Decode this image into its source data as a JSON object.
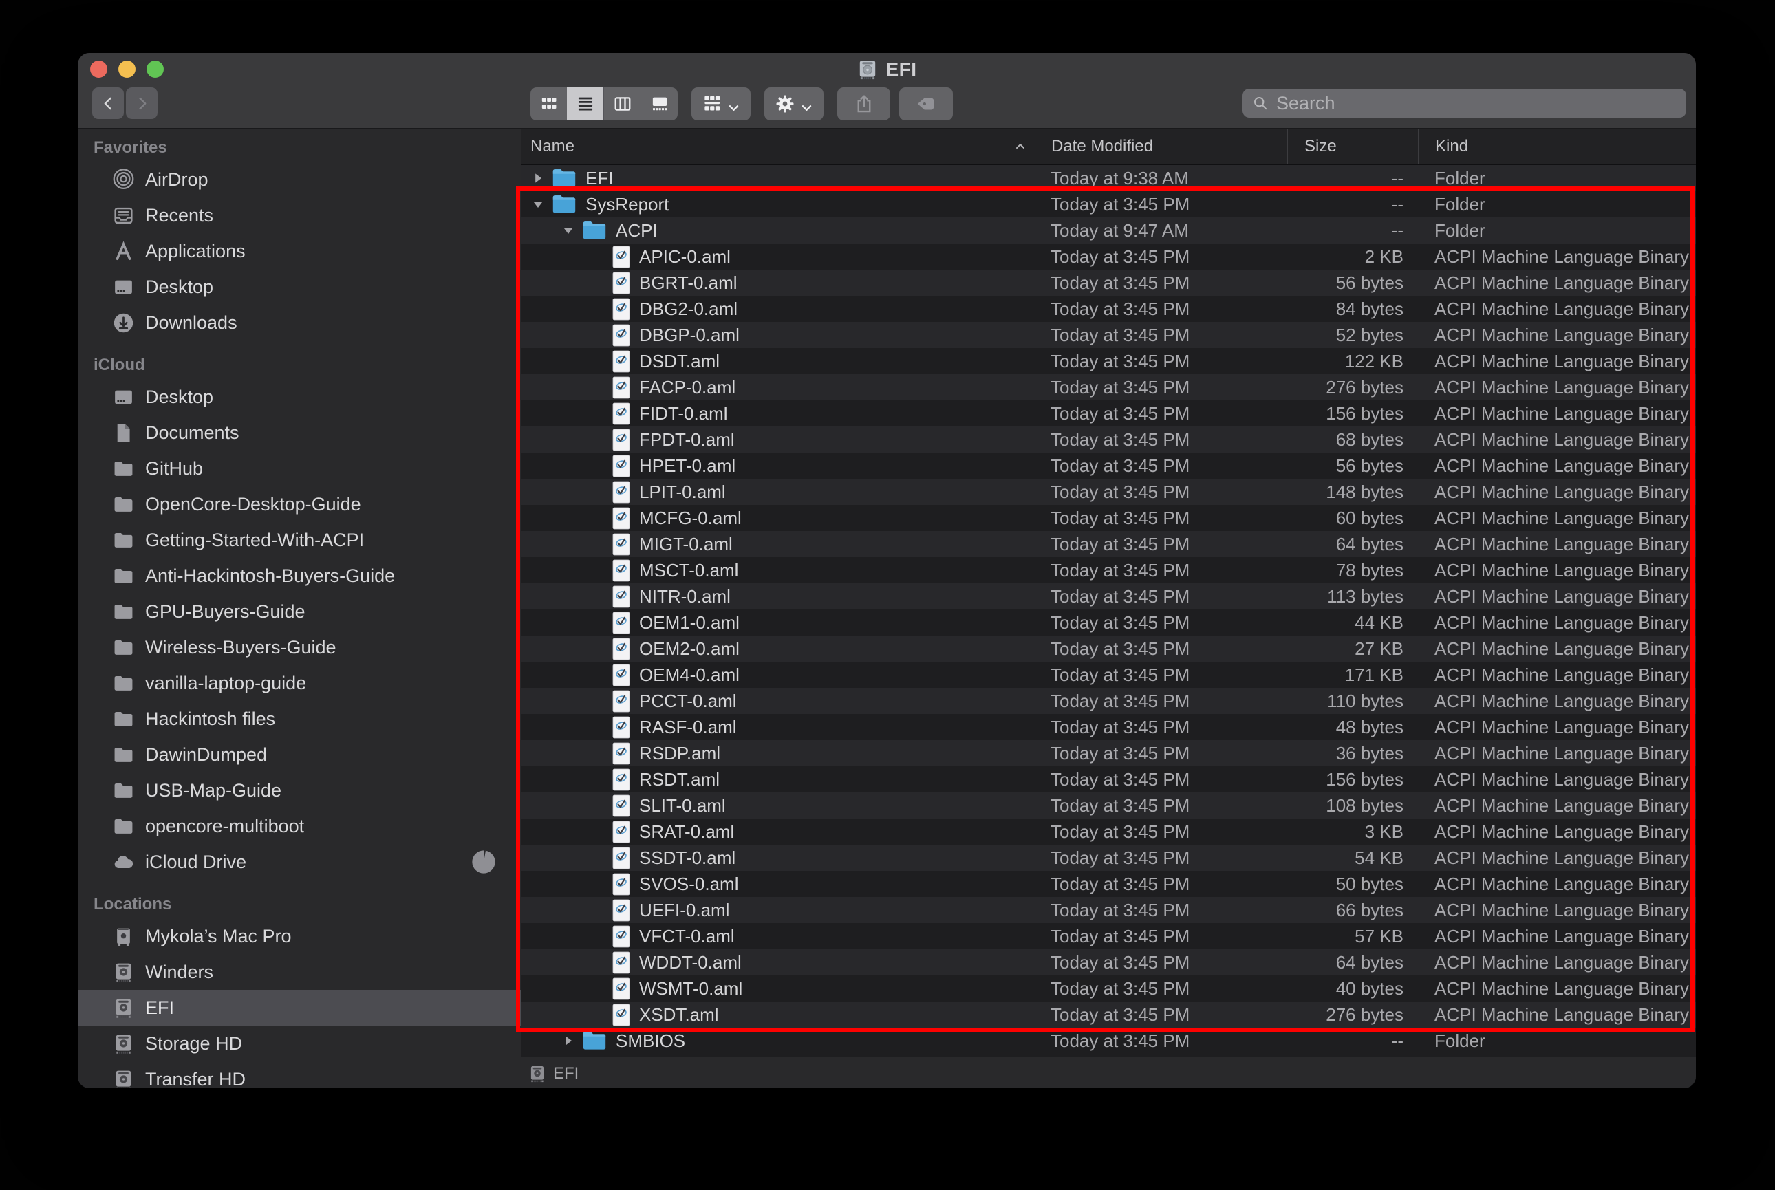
{
  "titlebar": {
    "title": "EFI",
    "title_icon": "drive-silver-icon",
    "search_placeholder": "Search",
    "view_options": [
      {
        "id": "icon-view",
        "icon": "icon-view-icon",
        "selected": false
      },
      {
        "id": "list-view",
        "icon": "list-view-icon",
        "selected": true
      },
      {
        "id": "column-view",
        "icon": "column-view-icon",
        "selected": false
      },
      {
        "id": "gallery-view",
        "icon": "gallery-view-icon",
        "selected": false
      }
    ]
  },
  "sidebar": {
    "sections": [
      {
        "label": "Favorites",
        "items": [
          {
            "label": "AirDrop",
            "icon": "airdrop-icon"
          },
          {
            "label": "Recents",
            "icon": "recents-icon"
          },
          {
            "label": "Applications",
            "icon": "applications-icon"
          },
          {
            "label": "Desktop",
            "icon": "desktop-icon"
          },
          {
            "label": "Downloads",
            "icon": "downloads-icon"
          }
        ]
      },
      {
        "label": "iCloud",
        "items": [
          {
            "label": "Desktop",
            "icon": "desktop-icon"
          },
          {
            "label": "Documents",
            "icon": "document-icon"
          },
          {
            "label": "GitHub",
            "icon": "folder-icon"
          },
          {
            "label": "OpenCore-Desktop-Guide",
            "icon": "folder-icon"
          },
          {
            "label": "Getting-Started-With-ACPI",
            "icon": "folder-icon"
          },
          {
            "label": "Anti-Hackintosh-Buyers-Guide",
            "icon": "folder-icon"
          },
          {
            "label": "GPU-Buyers-Guide",
            "icon": "folder-icon"
          },
          {
            "label": "Wireless-Buyers-Guide",
            "icon": "folder-icon"
          },
          {
            "label": "vanilla-laptop-guide",
            "icon": "folder-icon"
          },
          {
            "label": "Hackintosh files",
            "icon": "folder-icon"
          },
          {
            "label": "DawinDumped",
            "icon": "folder-icon"
          },
          {
            "label": "USB-Map-Guide",
            "icon": "folder-icon"
          },
          {
            "label": "opencore-multiboot",
            "icon": "folder-icon"
          },
          {
            "label": "iCloud Drive",
            "icon": "cloud-icon",
            "badge": "sync-pie-icon"
          }
        ]
      },
      {
        "label": "Locations",
        "items": [
          {
            "label": "Mykola’s Mac Pro",
            "icon": "macpro-icon"
          },
          {
            "label": "Winders",
            "icon": "drive-icon"
          },
          {
            "label": "EFI",
            "icon": "drive-icon",
            "selected": true
          },
          {
            "label": "Storage HD",
            "icon": "drive-icon"
          },
          {
            "label": "Transfer HD",
            "icon": "drive-icon"
          }
        ]
      }
    ]
  },
  "list": {
    "columns": [
      {
        "id": "name",
        "label": "Name",
        "sorted": "ascending"
      },
      {
        "id": "date",
        "label": "Date Modified"
      },
      {
        "id": "size",
        "label": "Size"
      },
      {
        "id": "kind",
        "label": "Kind"
      }
    ],
    "rows": [
      {
        "name": "EFI",
        "depth": 0,
        "icon": "folder-blue-icon",
        "twisty": "collapsed",
        "date": "Today at 9:38 AM",
        "size": "--",
        "kind": "Folder"
      },
      {
        "name": "SysReport",
        "depth": 0,
        "icon": "folder-blue-icon",
        "twisty": "expanded",
        "date": "Today at 3:45 PM",
        "size": "--",
        "kind": "Folder"
      },
      {
        "name": "ACPI",
        "depth": 1,
        "icon": "folder-blue-icon",
        "twisty": "expanded",
        "date": "Today at 9:47 AM",
        "size": "--",
        "kind": "Folder"
      },
      {
        "name": "APIC-0.aml",
        "depth": 2,
        "icon": "aml-file-icon",
        "twisty": "none",
        "date": "Today at 3:45 PM",
        "size": "2 KB",
        "kind": "ACPI Machine Language Binary"
      },
      {
        "name": "BGRT-0.aml",
        "depth": 2,
        "icon": "aml-file-icon",
        "twisty": "none",
        "date": "Today at 3:45 PM",
        "size": "56 bytes",
        "kind": "ACPI Machine Language Binary"
      },
      {
        "name": "DBG2-0.aml",
        "depth": 2,
        "icon": "aml-file-icon",
        "twisty": "none",
        "date": "Today at 3:45 PM",
        "size": "84 bytes",
        "kind": "ACPI Machine Language Binary"
      },
      {
        "name": "DBGP-0.aml",
        "depth": 2,
        "icon": "aml-file-icon",
        "twisty": "none",
        "date": "Today at 3:45 PM",
        "size": "52 bytes",
        "kind": "ACPI Machine Language Binary"
      },
      {
        "name": "DSDT.aml",
        "depth": 2,
        "icon": "aml-file-icon",
        "twisty": "none",
        "date": "Today at 3:45 PM",
        "size": "122 KB",
        "kind": "ACPI Machine Language Binary"
      },
      {
        "name": "FACP-0.aml",
        "depth": 2,
        "icon": "aml-file-icon",
        "twisty": "none",
        "date": "Today at 3:45 PM",
        "size": "276 bytes",
        "kind": "ACPI Machine Language Binary"
      },
      {
        "name": "FIDT-0.aml",
        "depth": 2,
        "icon": "aml-file-icon",
        "twisty": "none",
        "date": "Today at 3:45 PM",
        "size": "156 bytes",
        "kind": "ACPI Machine Language Binary"
      },
      {
        "name": "FPDT-0.aml",
        "depth": 2,
        "icon": "aml-file-icon",
        "twisty": "none",
        "date": "Today at 3:45 PM",
        "size": "68 bytes",
        "kind": "ACPI Machine Language Binary"
      },
      {
        "name": "HPET-0.aml",
        "depth": 2,
        "icon": "aml-file-icon",
        "twisty": "none",
        "date": "Today at 3:45 PM",
        "size": "56 bytes",
        "kind": "ACPI Machine Language Binary"
      },
      {
        "name": "LPIT-0.aml",
        "depth": 2,
        "icon": "aml-file-icon",
        "twisty": "none",
        "date": "Today at 3:45 PM",
        "size": "148 bytes",
        "kind": "ACPI Machine Language Binary"
      },
      {
        "name": "MCFG-0.aml",
        "depth": 2,
        "icon": "aml-file-icon",
        "twisty": "none",
        "date": "Today at 3:45 PM",
        "size": "60 bytes",
        "kind": "ACPI Machine Language Binary"
      },
      {
        "name": "MIGT-0.aml",
        "depth": 2,
        "icon": "aml-file-icon",
        "twisty": "none",
        "date": "Today at 3:45 PM",
        "size": "64 bytes",
        "kind": "ACPI Machine Language Binary"
      },
      {
        "name": "MSCT-0.aml",
        "depth": 2,
        "icon": "aml-file-icon",
        "twisty": "none",
        "date": "Today at 3:45 PM",
        "size": "78 bytes",
        "kind": "ACPI Machine Language Binary"
      },
      {
        "name": "NITR-0.aml",
        "depth": 2,
        "icon": "aml-file-icon",
        "twisty": "none",
        "date": "Today at 3:45 PM",
        "size": "113 bytes",
        "kind": "ACPI Machine Language Binary"
      },
      {
        "name": "OEM1-0.aml",
        "depth": 2,
        "icon": "aml-file-icon",
        "twisty": "none",
        "date": "Today at 3:45 PM",
        "size": "44 KB",
        "kind": "ACPI Machine Language Binary"
      },
      {
        "name": "OEM2-0.aml",
        "depth": 2,
        "icon": "aml-file-icon",
        "twisty": "none",
        "date": "Today at 3:45 PM",
        "size": "27 KB",
        "kind": "ACPI Machine Language Binary"
      },
      {
        "name": "OEM4-0.aml",
        "depth": 2,
        "icon": "aml-file-icon",
        "twisty": "none",
        "date": "Today at 3:45 PM",
        "size": "171 KB",
        "kind": "ACPI Machine Language Binary"
      },
      {
        "name": "PCCT-0.aml",
        "depth": 2,
        "icon": "aml-file-icon",
        "twisty": "none",
        "date": "Today at 3:45 PM",
        "size": "110 bytes",
        "kind": "ACPI Machine Language Binary"
      },
      {
        "name": "RASF-0.aml",
        "depth": 2,
        "icon": "aml-file-icon",
        "twisty": "none",
        "date": "Today at 3:45 PM",
        "size": "48 bytes",
        "kind": "ACPI Machine Language Binary"
      },
      {
        "name": "RSDP.aml",
        "depth": 2,
        "icon": "aml-file-icon",
        "twisty": "none",
        "date": "Today at 3:45 PM",
        "size": "36 bytes",
        "kind": "ACPI Machine Language Binary"
      },
      {
        "name": "RSDT.aml",
        "depth": 2,
        "icon": "aml-file-icon",
        "twisty": "none",
        "date": "Today at 3:45 PM",
        "size": "156 bytes",
        "kind": "ACPI Machine Language Binary"
      },
      {
        "name": "SLIT-0.aml",
        "depth": 2,
        "icon": "aml-file-icon",
        "twisty": "none",
        "date": "Today at 3:45 PM",
        "size": "108 bytes",
        "kind": "ACPI Machine Language Binary"
      },
      {
        "name": "SRAT-0.aml",
        "depth": 2,
        "icon": "aml-file-icon",
        "twisty": "none",
        "date": "Today at 3:45 PM",
        "size": "3 KB",
        "kind": "ACPI Machine Language Binary"
      },
      {
        "name": "SSDT-0.aml",
        "depth": 2,
        "icon": "aml-file-icon",
        "twisty": "none",
        "date": "Today at 3:45 PM",
        "size": "54 KB",
        "kind": "ACPI Machine Language Binary"
      },
      {
        "name": "SVOS-0.aml",
        "depth": 2,
        "icon": "aml-file-icon",
        "twisty": "none",
        "date": "Today at 3:45 PM",
        "size": "50 bytes",
        "kind": "ACPI Machine Language Binary"
      },
      {
        "name": "UEFI-0.aml",
        "depth": 2,
        "icon": "aml-file-icon",
        "twisty": "none",
        "date": "Today at 3:45 PM",
        "size": "66 bytes",
        "kind": "ACPI Machine Language Binary"
      },
      {
        "name": "VFCT-0.aml",
        "depth": 2,
        "icon": "aml-file-icon",
        "twisty": "none",
        "date": "Today at 3:45 PM",
        "size": "57 KB",
        "kind": "ACPI Machine Language Binary"
      },
      {
        "name": "WDDT-0.aml",
        "depth": 2,
        "icon": "aml-file-icon",
        "twisty": "none",
        "date": "Today at 3:45 PM",
        "size": "64 bytes",
        "kind": "ACPI Machine Language Binary"
      },
      {
        "name": "WSMT-0.aml",
        "depth": 2,
        "icon": "aml-file-icon",
        "twisty": "none",
        "date": "Today at 3:45 PM",
        "size": "40 bytes",
        "kind": "ACPI Machine Language Binary"
      },
      {
        "name": "XSDT.aml",
        "depth": 2,
        "icon": "aml-file-icon",
        "twisty": "none",
        "date": "Today at 3:45 PM",
        "size": "276 bytes",
        "kind": "ACPI Machine Language Binary"
      },
      {
        "name": "SMBIOS",
        "depth": 1,
        "icon": "folder-blue-icon",
        "twisty": "collapsed",
        "date": "Today at 3:45 PM",
        "size": "--",
        "kind": "Folder"
      }
    ]
  },
  "statusbar": {
    "icon": "drive-icon",
    "label": "EFI"
  },
  "highlight": {
    "color": "#fe0100"
  }
}
